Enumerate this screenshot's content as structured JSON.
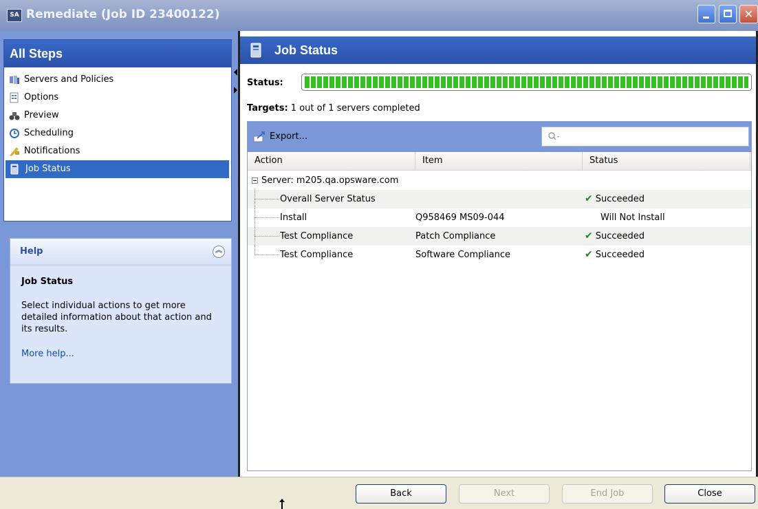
{
  "window": {
    "app_badge": "SA",
    "title": "Remediate (Job ID 23400122)",
    "controls": {
      "minimize": "minimize-icon",
      "maximize": "maximize-icon",
      "close": "close-icon"
    }
  },
  "steps": {
    "header": "All Steps",
    "items": [
      {
        "label": "Servers and Policies",
        "icon": "servers-icon",
        "selected": false
      },
      {
        "label": "Options",
        "icon": "options-icon",
        "selected": false
      },
      {
        "label": "Preview",
        "icon": "binoculars-icon",
        "selected": false
      },
      {
        "label": "Scheduling",
        "icon": "clock-icon",
        "selected": false
      },
      {
        "label": "Notifications",
        "icon": "envelope-icon",
        "selected": false
      },
      {
        "label": "Job Status",
        "icon": "server-status-icon",
        "selected": true
      }
    ]
  },
  "help": {
    "header": "Help",
    "title": "Job Status",
    "body": "Select individual actions to get more detailed information about that action and its results.",
    "link": "More help..."
  },
  "job_status": {
    "header": "Job Status",
    "status_label": "Status:",
    "progress": 1.0,
    "targets_label": "Targets:",
    "targets_value": "1 out of 1 servers completed"
  },
  "toolbar": {
    "export_label": "Export...",
    "search_placeholder": ""
  },
  "table": {
    "columns": [
      "Action",
      "Item",
      "Status"
    ],
    "server": "Server: m205.qa.opsware.com",
    "rows": [
      {
        "action": "Overall Server Status",
        "item": "",
        "status": "Succeeded",
        "check": true
      },
      {
        "action": "Install",
        "item": "Q958469 MS09-044",
        "status": "Will Not Install",
        "check": false
      },
      {
        "action": "Test Compliance",
        "item": "Patch Compliance",
        "status": "Succeeded",
        "check": true
      },
      {
        "action": "Test Compliance",
        "item": "Software Compliance",
        "status": "Succeeded",
        "check": true
      }
    ]
  },
  "footer": {
    "back": "Back",
    "next": "Next",
    "end_job": "End Job",
    "close": "Close"
  },
  "colors": {
    "accent": "#2a53aa",
    "panel": "#7a97d8",
    "success": "#1e8a1e",
    "progress": "#33c11f"
  }
}
